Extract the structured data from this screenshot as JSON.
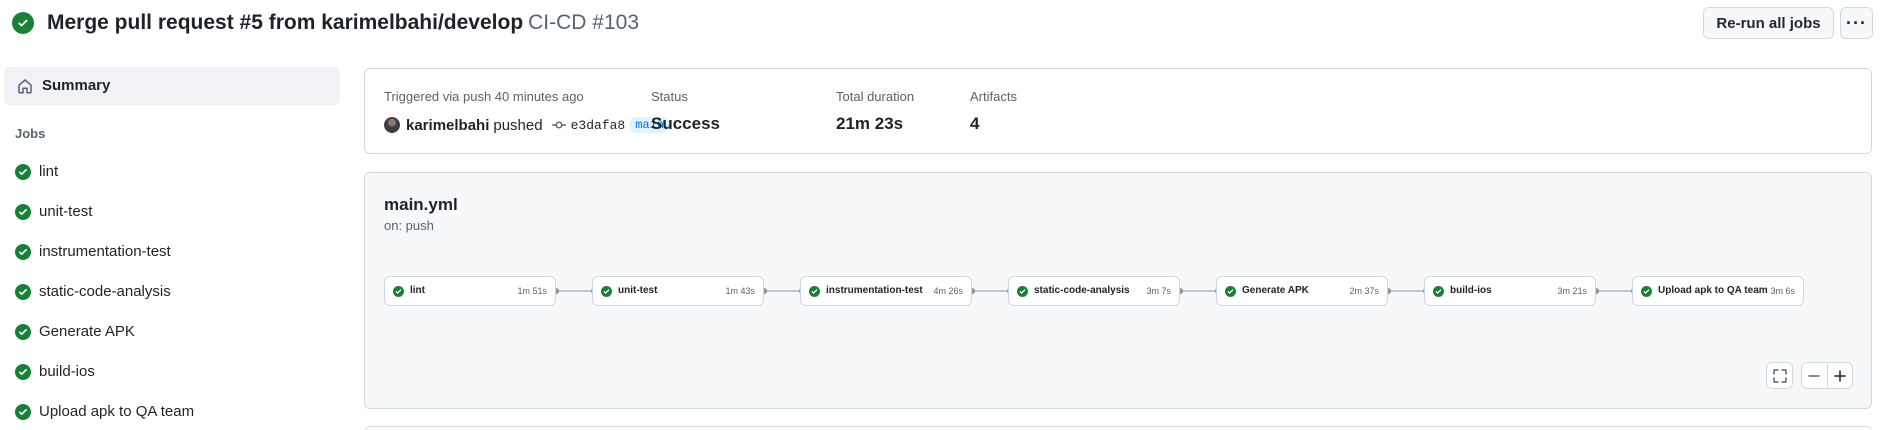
{
  "header": {
    "title": "Merge pull request #5 from karimelbahi/develop",
    "workflow_run": "CI-CD #103",
    "rerun_label": "Re-run all jobs",
    "more_label": "···"
  },
  "sidebar": {
    "summary_label": "Summary",
    "jobs_heading": "Jobs",
    "jobs": [
      {
        "label": "lint"
      },
      {
        "label": "unit-test"
      },
      {
        "label": "instrumentation-test"
      },
      {
        "label": "static-code-analysis"
      },
      {
        "label": "Generate APK"
      },
      {
        "label": "build-ios"
      },
      {
        "label": "Upload apk to QA team"
      }
    ]
  },
  "summary": {
    "trigger_text": "Triggered via push 40 minutes ago",
    "actor": "karimelbahi",
    "action": "pushed",
    "commit_sha": "e3dafa8",
    "branch": "main",
    "status_label": "Status",
    "status_value": "Success",
    "duration_label": "Total duration",
    "duration_value": "21m 23s",
    "artifacts_label": "Artifacts",
    "artifacts_value": "4"
  },
  "workflow": {
    "file": "main.yml",
    "trigger": "on: push",
    "nodes": [
      {
        "label": "lint",
        "duration": "1m 51s"
      },
      {
        "label": "unit-test",
        "duration": "1m 43s"
      },
      {
        "label": "instrumentation-test",
        "duration": "4m 26s"
      },
      {
        "label": "static-code-analysis",
        "duration": "3m 7s"
      },
      {
        "label": "Generate APK",
        "duration": "2m 37s"
      },
      {
        "label": "build-ios",
        "duration": "3m 21s"
      },
      {
        "label": "Upload apk to QA team",
        "duration": "3m 6s"
      }
    ]
  },
  "colors": {
    "success": "#1a7f37",
    "branch_bg": "#ddf4ff",
    "branch_text": "#0969da",
    "border": "#d1d9e0"
  },
  "icons": {
    "status": "check-circle-icon",
    "summary": "home-icon",
    "commit": "git-commit-icon",
    "fit": "fullscreen-icon",
    "zoom_out": "minus-icon",
    "zoom_in": "plus-icon"
  }
}
